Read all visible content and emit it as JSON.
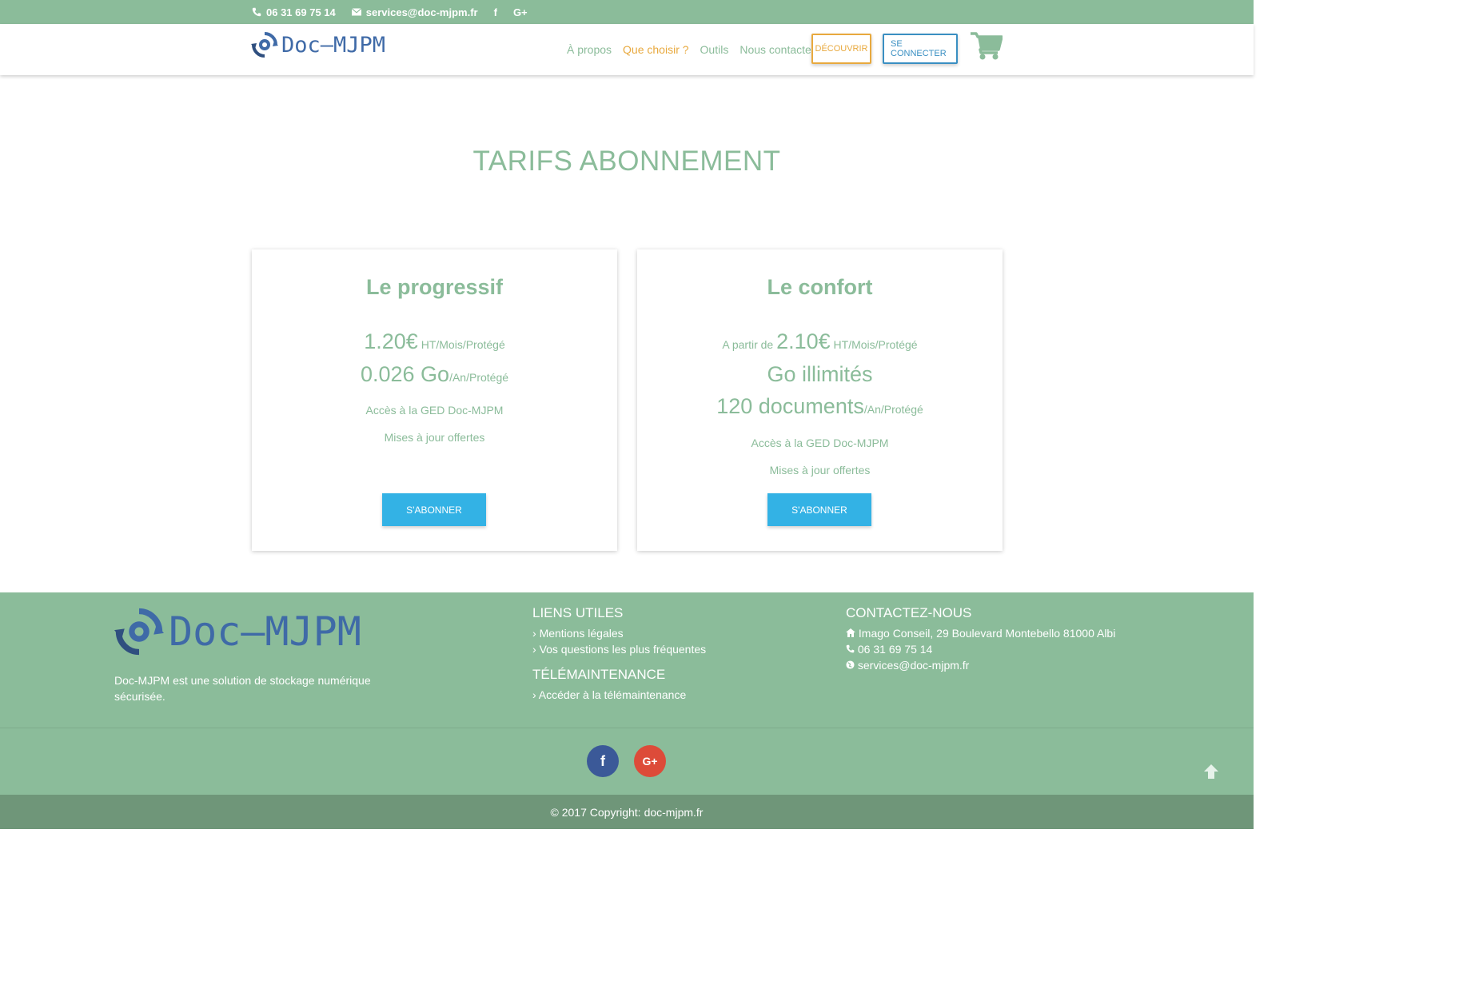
{
  "topbar": {
    "phone": "06 31 69 75 14",
    "email": "services@doc-mjpm.fr",
    "facebook_glyph": "f",
    "gplus_glyph": "G+"
  },
  "brand": {
    "name": "Doc–MJPM",
    "color": "#3f6aa7",
    "accent": "#8bbc9a",
    "orange": "#e8a93e",
    "button_blue": "#33b2e5"
  },
  "nav": {
    "items": [
      {
        "label": "À propos",
        "active": false
      },
      {
        "label": "Que choisir ?",
        "active": true
      },
      {
        "label": "Outils",
        "active": false
      },
      {
        "label": "Nous contacter",
        "active": false
      }
    ],
    "discover_label": "DÉCOUVRIR",
    "connect_label": "SE CONNECTER",
    "cart_icon": "shopping-cart-icon"
  },
  "page": {
    "title": "TARIFS ABONNEMENT"
  },
  "plans": [
    {
      "name": "Le progressif",
      "price": "1.20€",
      "price_unit": " HT/Mois/Protégé",
      "storage": "0.026 Go",
      "storage_unit": "/An/Protégé",
      "features": [
        "Accès à la GED Doc-MJPM",
        "Mises à jour offertes"
      ],
      "button": "S'ABONNER"
    },
    {
      "name": "Le confort",
      "price_prefix": "A partir de ",
      "price": "2.10€",
      "price_unit": " HT/Mois/Protégé",
      "storage": "Go illimités",
      "documents": "120 documents",
      "documents_unit": "/An/Protégé",
      "features": [
        "Accès à la GED Doc-MJPM",
        "Mises à jour offertes"
      ],
      "button": "S'ABONNER"
    }
  ],
  "footer": {
    "logo_text": "Doc–MJPM",
    "description": "Doc-MJPM est une solution de stockage numérique sécurisée.",
    "links_title": "LIENS UTILES",
    "links": [
      "Mentions légales",
      "Vos questions les plus fréquentes"
    ],
    "maint_title": "TÉLÉMAINTENANCE",
    "maint_links": [
      "Accéder à la télémaintenance"
    ],
    "contact_title": "CONTACTEZ-NOUS",
    "address": "Imago Conseil, 29 Boulevard Montebello 81000 Albi",
    "phone": "06 31 69 75 14",
    "email": "services@doc-mjpm.fr",
    "social_fb": "f",
    "social_gp": "G+",
    "copyright_prefix": "© 2017 Copyright:",
    "copyright_site": "doc-mjpm.fr"
  }
}
